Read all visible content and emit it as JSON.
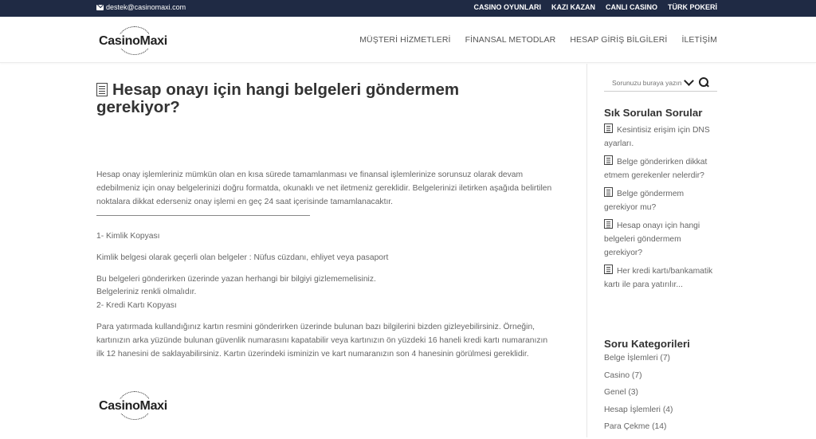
{
  "topbar": {
    "email": "destek@casinomaxi.com",
    "links": [
      "CASINO OYUNLARI",
      "KAZI KAZAN",
      "CANLI CASINO",
      "TÜRK POKERİ"
    ]
  },
  "header": {
    "logo": "CasinoMaxi",
    "nav": [
      "MÜŞTERİ HİZMETLERİ",
      "FİNANSAL METODLAR",
      "HESAP GİRİŞ BİLGİLERİ",
      "İLETİŞİM"
    ]
  },
  "article": {
    "title": "Hesap onayı için hangi belgeleri göndermem gerekiyor?",
    "intro": "Hesap onay işlemleriniz mümkün olan en kısa sürede tamamlanması ve finansal işlemlerinize sorunsuz olarak devam edebilmeniz için onay belgelerinizi doğru formatda, okunaklı ve net iletmeniz gereklidir. Belgelerinizi iletirken aşağıda belirtilen noktalara dikkat ederseniz onay işlemi en geç 24 saat içerisinde tamamlanacaktır.",
    "s1_title": "1- Kimlik Kopyası",
    "s1_body": "Kimlik belgesi olarak geçerli olan belgeler : Nüfus cüzdanı, ehliyet veya pasaport",
    "s1_note1": "Bu belgeleri gönderirken üzerinde yazan herhangi bir bilgiyi gizlememelisiniz.",
    "s1_note2": "Belgeleriniz renkli olmalıdır.",
    "s2_title": "2- Kredi Kartı Kopyası",
    "s2_body": "Para yatırmada kullandığınız kartın resmini gönderirken üzerinde bulunan bazı bilgilerini bizden gizleyebilirsiniz. Örneğin, kartınızın arka yüzünde bulunan güvenlik numarasını kapatabilir veya kartınızın ön yüzdeki 16 haneli kredi kartı numaranızın ilk 12 hanesini de saklayabilirsiniz. Kartın üzerindeki isminizin ve kart numaranızın son 4 hanesinin görülmesi gereklidir.",
    "footer_logo": "CasinoMaxi"
  },
  "sidebar": {
    "search_placeholder": "Sorunuzu buraya yazın",
    "faq_title": "Sık Sorulan Sorular",
    "faq": [
      "Kesintisiz erişim için DNS ayarları.",
      "Belge gönderirken dikkat etmem gerekenler nelerdir?",
      "Belge göndermem gerekiyor mu?",
      "Hesap onayı için hangi belgeleri göndermem gerekiyor?",
      "Her kredi kartı/bankamatik kartı ile para yatırılır..."
    ],
    "categories_title": "Soru Kategorileri",
    "categories": [
      "Belge İşlemleri (7)",
      "Casino (7)",
      "Genel (3)",
      "Hesap İşlemleri (4)",
      "Para Çekme (14)"
    ]
  }
}
